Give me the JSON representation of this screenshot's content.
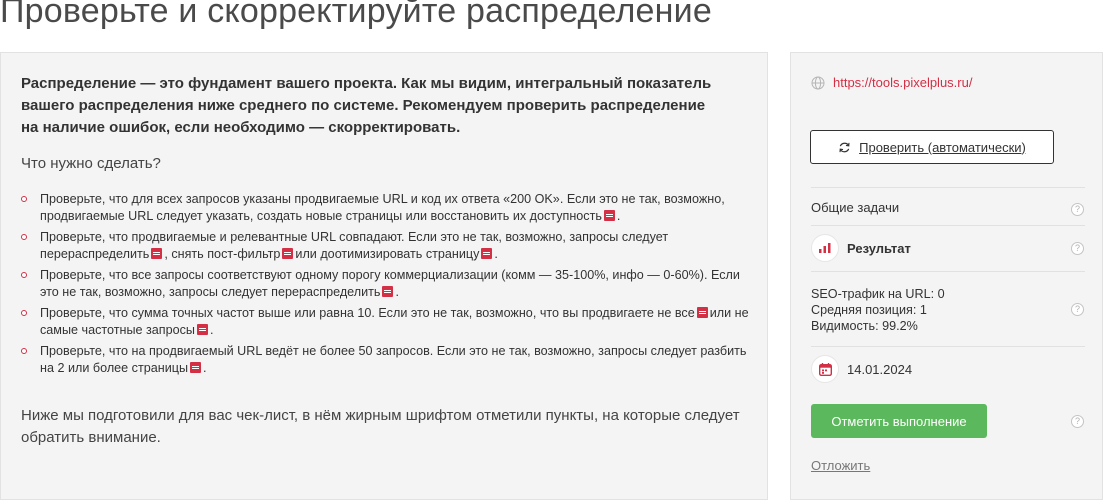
{
  "page": {
    "title": "Проверьте и скорректируйте распределение"
  },
  "main": {
    "intro": "Распределение — это фундамент вашего проекта. Как мы видим, интегральный показатель вашего распределения ниже среднего по системе. Рекомендуем проверить распределение на наличие ошибок, если необходимо — скорректировать.",
    "what_to_do": "Что нужно сделать?",
    "tasks": [
      {
        "parts": [
          "Проверьте, что для всех запросов указаны продвигаемые URL и код их ответа «200 OK». Если это не так, возможно, продвигаемые URL следует указать, создать новые страницы или восстановить их доступность",
          "."
        ]
      },
      {
        "parts": [
          "Проверьте, что продвигаемые и релевантные URL совпадают. Если это не так, возможно, запросы следует перераспределить",
          ", снять пост-фильтр",
          "или доотимизировать страницу",
          "."
        ]
      },
      {
        "parts": [
          "Проверьте, что все запросы соответствуют одному порогу коммерциализации (комм — 35-100%, инфо — 0-60%). Если это не так, возможно, запросы следует перераспределить",
          "."
        ]
      },
      {
        "parts": [
          "Проверьте, что сумма точных частот выше или равна 10. Если это не так, возможно, что вы продвигаете не все",
          "или не самые частотные запросы",
          "."
        ]
      },
      {
        "parts": [
          "Проверьте, что на продвигаемый URL ведёт не более 50 запросов. Если это не так, возможно, запросы следует разбить на 2 или более страницы",
          "."
        ]
      }
    ],
    "outro": "Ниже мы подготовили для вас чек-лист, в нём жирным шрифтом отметили пункты, на которые следует обратить внимание."
  },
  "sidebar": {
    "site_url": "https://tools.pixelplus.ru/",
    "check_button": "Проверить (автоматически)",
    "general_tasks": "Общие задачи",
    "result_label": "Результат",
    "stats": {
      "seo_traffic": "SEO-трафик на URL: 0",
      "avg_position": "Средняя позиция: 1",
      "visibility": "Видимость: 99.2%"
    },
    "date": "14.01.2024",
    "mark_done_button": "Отметить выполнение",
    "postpone": "Отложить",
    "help_symbol": "?"
  },
  "colors": {
    "accent": "#d32f45",
    "success": "#5cb85c",
    "panel_bg": "#f4f4f4"
  },
  "icons": {
    "doc_link": "book-icon",
    "site": "globe-icon",
    "check": "refresh-icon",
    "result": "bar-chart-icon",
    "date": "calendar-icon",
    "help": "help-icon"
  }
}
